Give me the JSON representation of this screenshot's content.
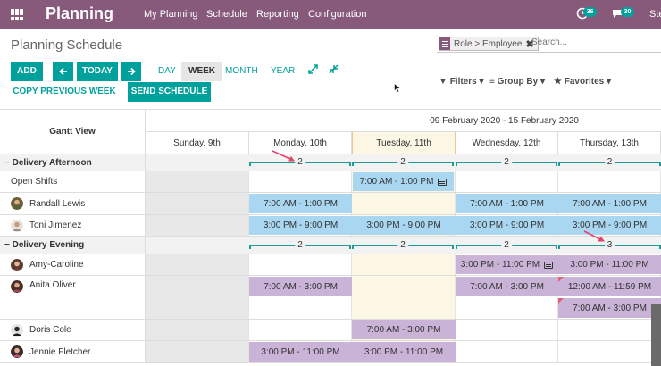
{
  "app": {
    "name": "Planning",
    "menu": [
      "My Planning",
      "Schedule",
      "Reporting",
      "Configuration"
    ],
    "activity_count": "36",
    "message_count": "30",
    "user_truncated": "Ste"
  },
  "control": {
    "title": "Planning Schedule",
    "facet_label": "Role > Employee",
    "search_placeholder": "Search...",
    "add_label": "ADD",
    "today_label": "TODAY",
    "prev_icon": "left-arrow-icon",
    "next_icon": "right-arrow-icon",
    "copy_previous_label": "COPY PREVIOUS WEEK",
    "send_schedule_label": "SEND SCHEDULE",
    "scales": [
      "DAY",
      "WEEK",
      "MONTH",
      "YEAR"
    ],
    "active_scale": "WEEK",
    "filters_label": "Filters",
    "group_by_label": "Group By",
    "favorites_label": "Favorites"
  },
  "gantt": {
    "view_title": "Gantt View",
    "range_label": "09 February 2020 - 15 February 2020",
    "days": [
      "Sunday, 9th",
      "Monday, 10th",
      "Tuesday, 11th",
      "Wednesday, 12th",
      "Thursday, 13th"
    ],
    "today_index": 2,
    "groups": [
      {
        "label": "− Delivery Afternoon",
        "counts": [
          "",
          "2",
          "2",
          "2",
          "2"
        ]
      },
      {
        "label": "− Delivery Evening",
        "counts": [
          "",
          "2",
          "2",
          "2",
          "3"
        ]
      }
    ],
    "rows": [
      {
        "label": "Open Shifts",
        "shifts": [
          "",
          "",
          "7:00 AM - 1:00 PM",
          "",
          ""
        ]
      },
      {
        "label": "Randall Lewis",
        "shifts": [
          "",
          "7:00 AM - 1:00 PM",
          "",
          "7:00 AM - 1:00 PM",
          "7:00 AM - 1:00 PM"
        ]
      },
      {
        "label": "Toni Jimenez",
        "shifts": [
          "",
          "3:00 PM - 9:00 PM",
          "3:00 PM - 9:00 PM",
          "3:00 PM - 9:00 PM",
          "3:00 PM - 9:00 PM"
        ]
      },
      {
        "label": "Amy-Caroline",
        "shifts": [
          "",
          "",
          "",
          "3:00 PM - 11:00 PM",
          "3:00 PM - 11:00 PM"
        ]
      },
      {
        "label": "Anita Oliver",
        "shifts": [
          "",
          "7:00 AM - 3:00 PM",
          "",
          "7:00 AM - 3:00 PM",
          "12:00 AM - 11:59 PM",
          "7:00 AM - 3:00 PM"
        ]
      },
      {
        "label": "Doris Cole",
        "shifts": [
          "",
          "",
          "7:00 AM - 3:00 PM",
          "",
          ""
        ]
      },
      {
        "label": "Jennie Fletcher",
        "shifts": [
          "",
          "3:00 PM - 11:00 PM",
          "3:00 PM - 11:00 PM",
          "",
          ""
        ]
      }
    ]
  },
  "colors": {
    "brand": "#875a7b",
    "accent": "#00a09d",
    "today_bg": "#fcf7e4",
    "afternoon_pill": "#a9d6f0",
    "evening_pill": "#c9b3d6",
    "annotation_arrow": "#e0446a"
  }
}
